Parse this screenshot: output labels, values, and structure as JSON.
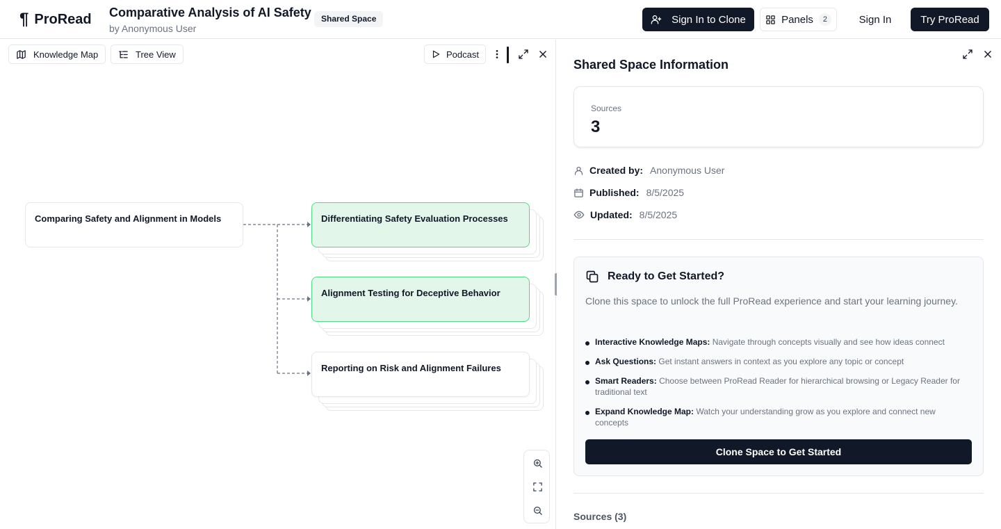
{
  "header": {
    "logo_mark": "¶",
    "logo_text": "ProRead",
    "title": "Comparative Analysis of AI Safety",
    "byline": "by Anonymous User",
    "badge": "Shared Space",
    "sign_in_to_clone": "Sign In to Clone",
    "panels_label": "Panels",
    "panels_count": "2",
    "sign_in": "Sign In",
    "try": "Try ProRead"
  },
  "toolbar": {
    "knowledge_map": "Knowledge Map",
    "tree_view": "Tree View",
    "podcast": "Podcast"
  },
  "map": {
    "root": "Comparing Safety and Alignment in Models",
    "children": [
      {
        "label": "Differentiating Safety Evaluation Processes",
        "highlighted": true
      },
      {
        "label": "Alignment Testing for Deceptive Behavior",
        "highlighted": true
      },
      {
        "label": "Reporting on Risk and Alignment Failures",
        "highlighted": false
      }
    ]
  },
  "info": {
    "title": "Shared Space Information",
    "sources_label": "Sources",
    "sources_value": "3",
    "created_label": "Created by:",
    "created_value": "Anonymous User",
    "published_label": "Published:",
    "published_value": "8/5/2025",
    "updated_label": "Updated:",
    "updated_value": "8/5/2025"
  },
  "ready": {
    "title": "Ready to Get Started?",
    "description": "Clone this space to unlock the full ProRead experience and start your learning journey.",
    "features": [
      {
        "title": "Interactive Knowledge Maps:",
        "text": "Navigate through concepts visually and see how ideas connect"
      },
      {
        "title": "Ask Questions:",
        "text": "Get instant answers in context as you explore any topic or concept"
      },
      {
        "title": "Smart Readers:",
        "text": "Choose between ProRead Reader for hierarchical browsing or Legacy Reader for traditional text"
      },
      {
        "title": "Expand Knowledge Map:",
        "text": "Watch your understanding grow as you explore and connect new concepts"
      }
    ],
    "clone_button": "Clone Space to Get Started"
  },
  "sources_section": "Sources (3)"
}
